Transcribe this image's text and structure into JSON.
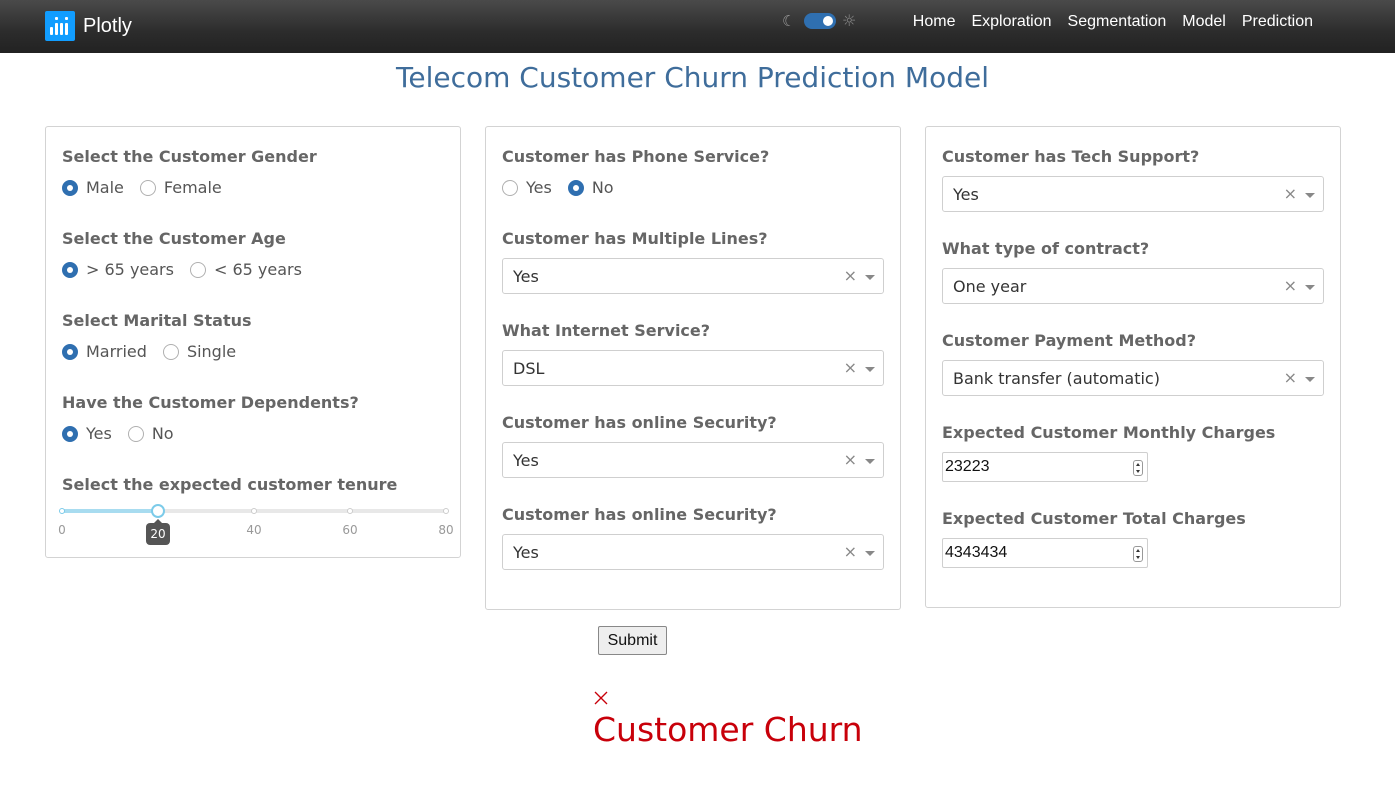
{
  "navbar": {
    "brand": "Plotly",
    "links": [
      "Home",
      "Exploration",
      "Segmentation",
      "Model",
      "Prediction"
    ]
  },
  "page_title": "Telecom Customer Churn Prediction Model",
  "card1": {
    "gender": {
      "label": "Select the Customer Gender",
      "options": [
        "Male",
        "Female"
      ],
      "selected": "Male"
    },
    "age": {
      "label": "Select the Customer Age",
      "options": [
        "> 65 years",
        "< 65 years"
      ],
      "selected": "> 65 years"
    },
    "marital": {
      "label": "Select Marital Status",
      "options": [
        "Married",
        "Single"
      ],
      "selected": "Married"
    },
    "dependents": {
      "label": "Have the Customer Dependents?",
      "options": [
        "Yes",
        "No"
      ],
      "selected": "Yes"
    },
    "tenure": {
      "label": "Select the expected customer tenure",
      "min": 0,
      "max": 80,
      "value": 20,
      "value_label": "20",
      "ticks": [
        "0",
        "20",
        "40",
        "60",
        "80"
      ]
    }
  },
  "card2": {
    "phone": {
      "label": "Customer has Phone Service?",
      "options": [
        "Yes",
        "No"
      ],
      "selected": "No"
    },
    "multiple_lines": {
      "label": "Customer has Multiple Lines?",
      "value": "Yes"
    },
    "internet": {
      "label": "What Internet Service?",
      "value": "DSL"
    },
    "security1": {
      "label": "Customer has online Security?",
      "value": "Yes"
    },
    "security2": {
      "label": "Customer has online Security?",
      "value": "Yes"
    }
  },
  "card3": {
    "tech_support": {
      "label": "Customer has Tech Support?",
      "value": "Yes"
    },
    "contract": {
      "label": "What type of contract?",
      "value": "One year"
    },
    "payment": {
      "label": "Customer Payment Method?",
      "value": "Bank transfer (automatic)"
    },
    "monthly": {
      "label": "Expected Customer Monthly Charges",
      "value": "23223"
    },
    "total": {
      "label": "Expected Customer Total Charges",
      "value": "4343434"
    }
  },
  "submit_label": "Submit",
  "result": {
    "text": "Customer Churn",
    "icon": "x-icon",
    "color": "#c8000a"
  },
  "colors": {
    "accent": "#2f6fb0",
    "title": "#3f6d9b",
    "brand": "#119dff"
  },
  "dropdown_clear_glyph": "×"
}
